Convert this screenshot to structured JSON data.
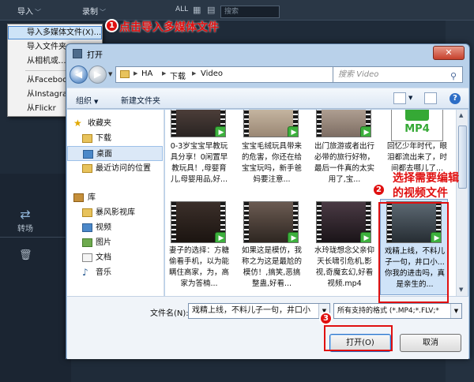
{
  "editor": {
    "menu_import": "导入",
    "menu_record": "录制",
    "all_label": "ALL",
    "search_placeholder": "搜索",
    "transition_label": "转场"
  },
  "import_menu": {
    "items": [
      {
        "label": "导入多媒体文件(X)..."
      },
      {
        "label": "导入文件夹"
      },
      {
        "label": "从相机或..."
      },
      {
        "label": "从Facebook"
      },
      {
        "label": "从Instagram"
      },
      {
        "label": "从Flickr"
      }
    ]
  },
  "annotations": {
    "step1_number": "1",
    "step1_text": "点击导入多媒体文件",
    "step2_number": "2",
    "step2_text_line1": "选择需要编辑",
    "step2_text_line2": "的视频文件",
    "step3_number": "3",
    "accent_color": "#e01010"
  },
  "dialog": {
    "title": "打开",
    "close_symbol": "✕",
    "breadcrumbs": [
      "HA",
      "下载",
      "Video"
    ],
    "search_placeholder": "搜索 Video",
    "toolbar": {
      "organize": "组织",
      "new_folder": "新建文件夹"
    },
    "nav": {
      "favorites_header": "收藏夹",
      "downloads": "下载",
      "desktop": "桌面",
      "recent": "最近访问的位置",
      "libraries_header": "库",
      "storm_lib": "暴风影视库",
      "videos": "视频",
      "pictures": "图片",
      "documents": "文档",
      "music": "音乐"
    },
    "files": [
      {
        "label": "0-3岁宝宝早教玩具分享！0闲置早教玩具！,母婴育儿,母婴用品,好..."
      },
      {
        "label": "宝宝毛绒玩具带来的危害，你还在给宝宝玩吗，新手爸妈要注意..."
      },
      {
        "label": "出门旅游或者出行必带的旅行好物，最后一件真的太实用了,宝..."
      },
      {
        "label": "回忆少年时代，眼泪都流出来了，时间都去哪儿了..."
      },
      {
        "label": "妻子的选择：方糖偷看手机，以为能瞒住高家，为，高家为答楠..."
      },
      {
        "label": "如果这是模仿，我称之为这是最尬的模仿！,搞笑,恶搞整蛊,好看..."
      },
      {
        "label": "水玲珑想念父亲仰天长啸引危机,影视,奇魔玄幻,好看视频.mp4"
      },
      {
        "label": "戏精上线，不料儿子一句，井口小...你我的进击吗，真是亲生的..."
      }
    ],
    "mp4_card_text": "MP4",
    "filename_label": "文件名(N):",
    "filename_value": "戏精上线，不料儿子一句，井口小",
    "filter_value": "所有支持的格式 (*.MP4;*.FLV;*",
    "open_button": "打开(O)",
    "cancel_button": "取消"
  }
}
